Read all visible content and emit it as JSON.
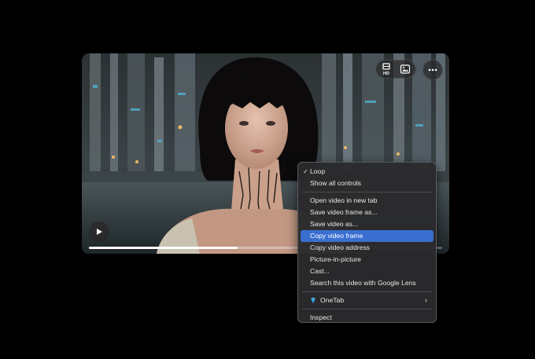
{
  "player": {
    "progress_fraction": 0.42,
    "hd_label": "HD",
    "icons": {
      "quality": "hd-icon",
      "frame": "image-icon",
      "more": "more-icon",
      "play": "play-icon"
    }
  },
  "context_menu": {
    "items": [
      {
        "label": "Loop",
        "checked": true
      },
      {
        "label": "Show all controls"
      },
      {
        "label": "Open video in new tab"
      },
      {
        "label": "Save video frame as..."
      },
      {
        "label": "Save video as..."
      },
      {
        "label": "Copy video frame",
        "highlighted": true
      },
      {
        "label": "Copy video address"
      },
      {
        "label": "Picture-in-picture"
      },
      {
        "label": "Cast..."
      },
      {
        "label": "Search this video with Google Lens"
      },
      {
        "label": "OneTab",
        "submenu": true,
        "icon": "onetab-icon"
      },
      {
        "label": "Inspect"
      }
    ],
    "check_mark": "✓",
    "submenu_arrow": "›",
    "highlight_color": "#3a6fd1"
  }
}
